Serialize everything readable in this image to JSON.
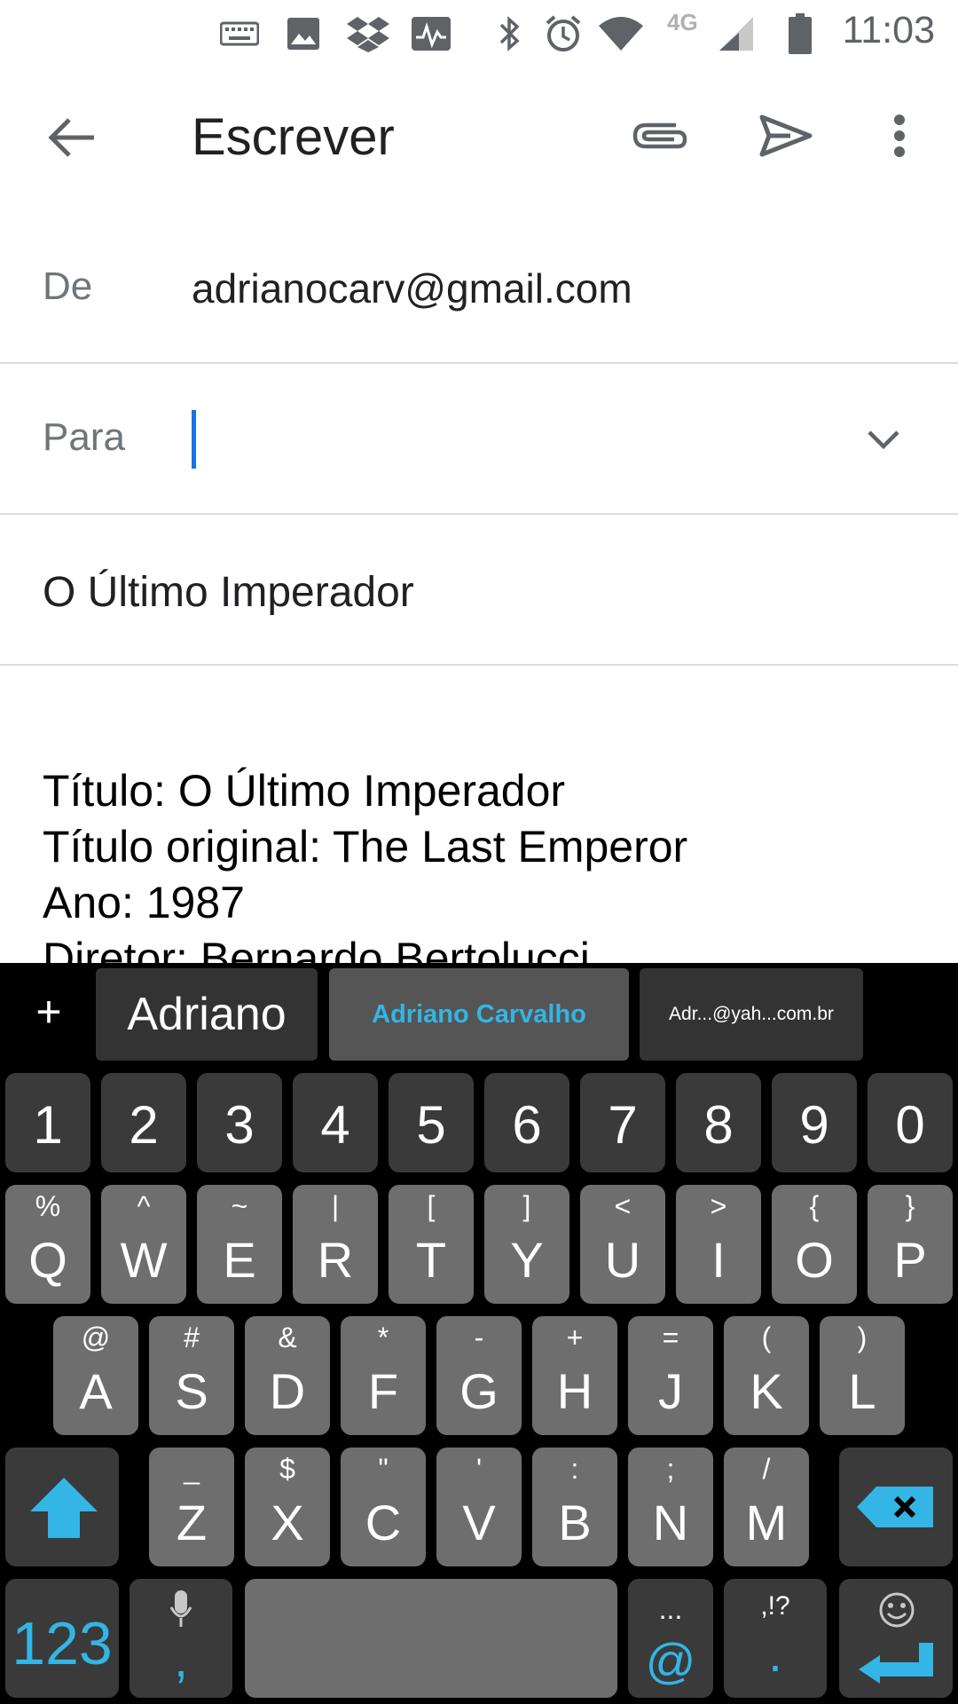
{
  "status_bar": {
    "time": "11:03",
    "network": "4G",
    "icons": [
      "keyboard-icon",
      "image-icon",
      "dropbox-icon",
      "activity-icon",
      "bluetooth-icon",
      "alarm-icon",
      "wifi-icon",
      "signal-icon",
      "battery-icon"
    ]
  },
  "app_bar": {
    "title": "Escrever",
    "icons": [
      "back-arrow-icon",
      "paperclip-icon",
      "send-icon",
      "more-vert-icon"
    ]
  },
  "compose": {
    "from_label": "De",
    "from_value": "adrianocarv@gmail.com",
    "to_label": "Para",
    "to_value": "",
    "subject": "O Último Imperador",
    "body_lines": [
      "Título: O Último Imperador",
      "Título original: The Last Emperor",
      "Ano: 1987",
      "Diretor: Bernardo Bertolucci"
    ]
  },
  "keyboard": {
    "add_label": "+",
    "suggestions": [
      "Adriano",
      "Adriano Carvalho",
      "Adr...@yah...com.br"
    ],
    "number_row": [
      "1",
      "2",
      "3",
      "4",
      "5",
      "6",
      "7",
      "8",
      "9",
      "0"
    ],
    "row1": [
      {
        "main": "Q",
        "alt": "%"
      },
      {
        "main": "W",
        "alt": "^"
      },
      {
        "main": "E",
        "alt": "~"
      },
      {
        "main": "R",
        "alt": "|"
      },
      {
        "main": "T",
        "alt": "["
      },
      {
        "main": "Y",
        "alt": "]"
      },
      {
        "main": "U",
        "alt": "<"
      },
      {
        "main": "I",
        "alt": ">"
      },
      {
        "main": "O",
        "alt": "{"
      },
      {
        "main": "P",
        "alt": "}"
      }
    ],
    "row2": [
      {
        "main": "A",
        "alt": "@"
      },
      {
        "main": "S",
        "alt": "#"
      },
      {
        "main": "D",
        "alt": "&"
      },
      {
        "main": "F",
        "alt": "*"
      },
      {
        "main": "G",
        "alt": "-"
      },
      {
        "main": "H",
        "alt": "+"
      },
      {
        "main": "J",
        "alt": "="
      },
      {
        "main": "K",
        "alt": "("
      },
      {
        "main": "L",
        "alt": ")"
      }
    ],
    "row3": [
      {
        "main": "Z",
        "alt": "_"
      },
      {
        "main": "X",
        "alt": "$"
      },
      {
        "main": "C",
        "alt": "\""
      },
      {
        "main": "V",
        "alt": "'"
      },
      {
        "main": "B",
        "alt": ":"
      },
      {
        "main": "N",
        "alt": ";"
      },
      {
        "main": "M",
        "alt": "/"
      }
    ],
    "symbols_label": "123",
    "comma_label": ",",
    "at_label": "@",
    "at_alt": "...",
    "period_label": ".",
    "period_alt": ",!?",
    "accent_color": "#33b5e5"
  }
}
